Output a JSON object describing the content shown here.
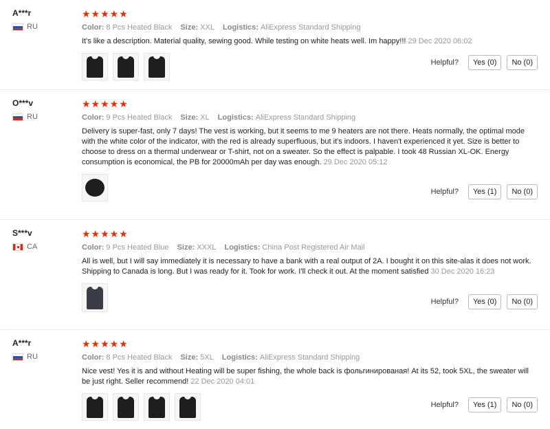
{
  "labels": {
    "color": "Color:",
    "size": "Size:",
    "logistics": "Logistics:",
    "helpful": "Helpful?"
  },
  "accent_star_color": "#e62e04",
  "reviews": [
    {
      "user": "A***r",
      "country": "RU",
      "flag": "flag-ru",
      "stars": "★★★★★",
      "color": "8 Pcs Heated Black",
      "size": "XXL",
      "logistics": "AliExpress Standard Shipping",
      "text": "It's like a description. Material quality, sewing good. While testing on white heats well. Im happy!!!",
      "date": "29 Dec 2020 06:02",
      "yes": "Yes (0)",
      "no": "No (0)",
      "image_count": 3
    },
    {
      "user": "O***v",
      "country": "RU",
      "flag": "flag-ru",
      "stars": "★★★★★",
      "color": "9 Pcs Heated Black",
      "size": "XL",
      "logistics": "AliExpress Standard Shipping",
      "text": "Delivery is super-fast, only 7 days! The vest is working, but it seems to me 9 heaters are not there. Heats normally, the optimal mode with the white color of the indicator, with the red is already superfluous, but it's indoors. I haven't experienced it yet. Size is better to choose to dress on a thermal underwear or T-shirt, not on a sweater. So the effect is palpable. I took 48 Russian XL-OK. Energy consumption is economical, the PB for 20000mAh per day was enough.",
      "date": "29 Dec 2020 05:12",
      "yes": "Yes (1)",
      "no": "No (0)",
      "image_count": 1
    },
    {
      "user": "S***v",
      "country": "CA",
      "flag": "flag-ca",
      "stars": "★★★★★",
      "color": "9 Pcs Heated Blue",
      "size": "XXXL",
      "logistics": "China Post Registered Air Mail",
      "text": "All is well, but I will say immediately it is necessary to have a bank with a real output of 2A. I bought it on this site-alas it does not work. Shipping to Canada is long. But I was ready for it. Took for work. I'll check it out. At the moment satisfied",
      "date": "30 Dec 2020 16:23",
      "yes": "Yes (0)",
      "no": "No (0)",
      "image_count": 1
    },
    {
      "user": "A***r",
      "country": "RU",
      "flag": "flag-ru",
      "stars": "★★★★★",
      "color": "8 Pcs Heated Black",
      "size": "5XL",
      "logistics": "AliExpress Standard Shipping",
      "text": "Nice vest! Yes it is and without Heating will be super fishing, the whole back is фольгинированая! At its 52, took 5XL, the sweater will be just right. Seller recommend!",
      "date": "22 Dec 2020 04:01",
      "yes": "Yes (1)",
      "no": "No (0)",
      "image_count": 4
    }
  ]
}
